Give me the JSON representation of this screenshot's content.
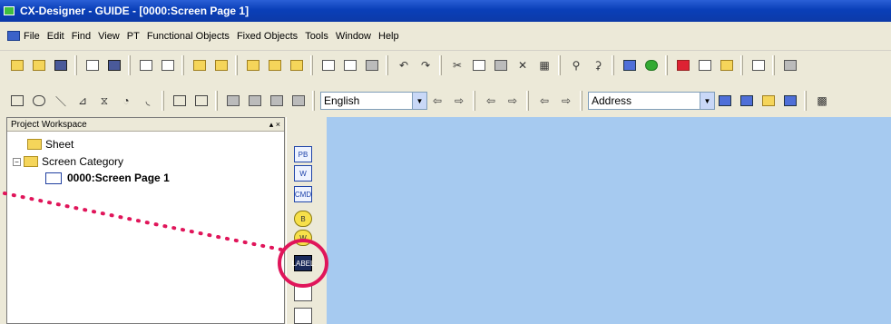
{
  "window": {
    "title": "CX-Designer - GUIDE - [0000:Screen Page 1]"
  },
  "menu": [
    "File",
    "Edit",
    "Find",
    "View",
    "PT",
    "Functional Objects",
    "Fixed Objects",
    "Tools",
    "Window",
    "Help"
  ],
  "toolbar2": {
    "language_value": "English",
    "address_value": "Address"
  },
  "workspace": {
    "header_title": "Project Workspace",
    "header_controls": "▴ ×",
    "tree": {
      "sheet": "Sheet",
      "screen_category": "Screen Category",
      "screen_page": "0000:Screen Page 1"
    }
  },
  "toolstrip": {
    "buttons": [
      "PB",
      "W",
      "CMD",
      "B",
      "W",
      "LABEL"
    ]
  },
  "colors": {
    "titlebar": "#0a3fb8",
    "canvas": "#a6caf0",
    "highlight_circle": "#e0155a",
    "dotted_line": "#e0155a"
  }
}
